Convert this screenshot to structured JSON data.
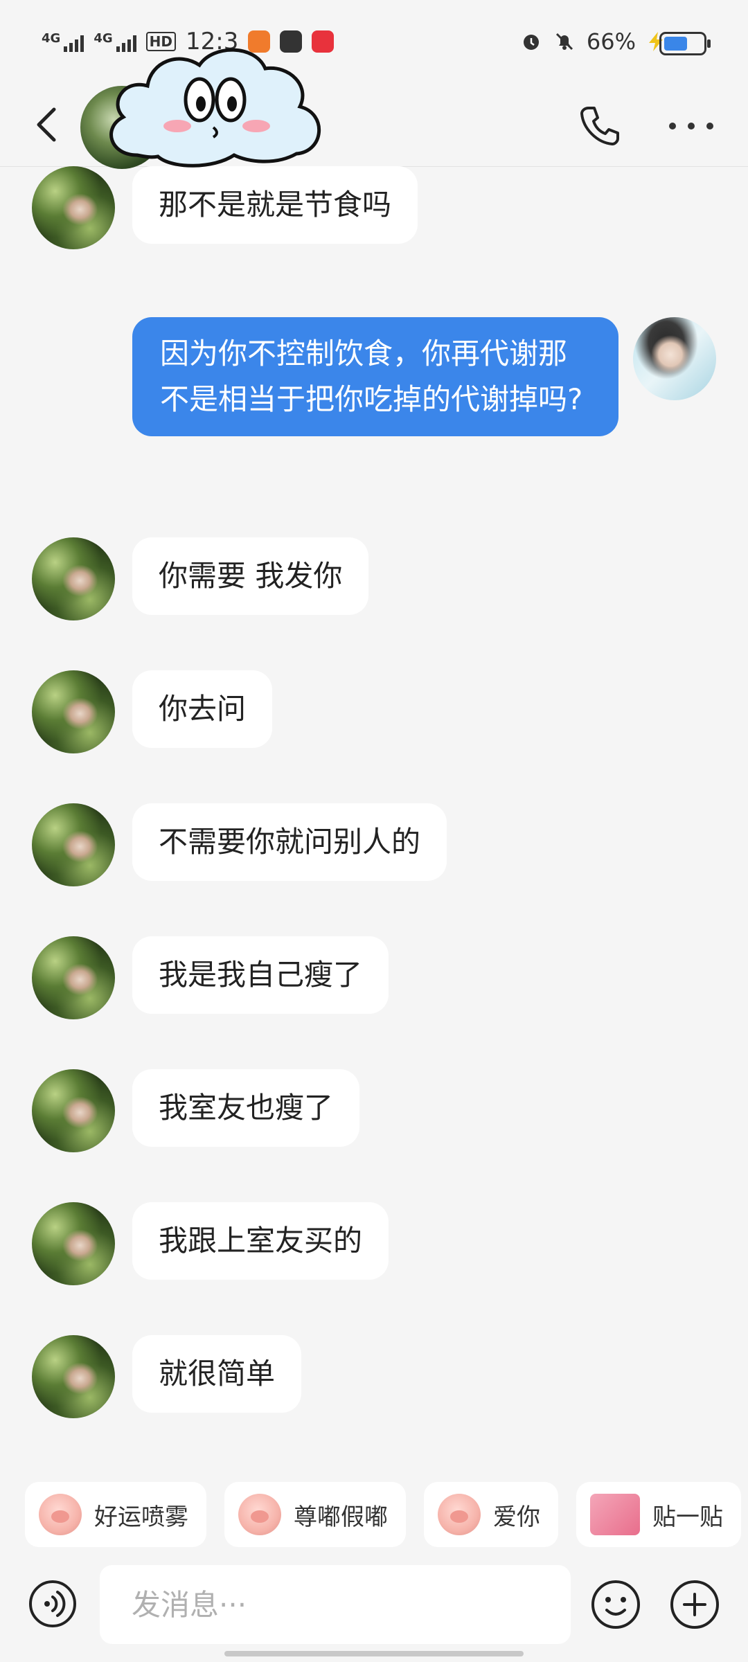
{
  "status_bar": {
    "network1": "4G",
    "network2": "4G",
    "hd": "HD",
    "time": "12:3",
    "battery_pct": "66%",
    "battery_level": 0.66,
    "icons": [
      "signal-icon",
      "hd-icon",
      "vibrate-icon",
      "app-icon",
      "video-app-icon",
      "shop-app-icon",
      "alarm-icon",
      "mute-icon",
      "charging-icon",
      "battery-icon"
    ]
  },
  "header": {
    "back_icon": "chevron-left-icon",
    "sticker": "cloud-face-sticker",
    "call_icon": "phone-icon",
    "more_icon": "more-dots-icon"
  },
  "messages": [
    {
      "side": "left",
      "text": "那不是就是节食吗"
    },
    {
      "side": "right",
      "text": "因为你不控制饮食，你再代谢那不是相当于把你吃掉的代谢掉吗?"
    },
    {
      "side": "left",
      "text": "你需要 我发你"
    },
    {
      "side": "left",
      "text": "你去问"
    },
    {
      "side": "left",
      "text": "不需要你就问别人的"
    },
    {
      "side": "left",
      "text": "我是我自己瘦了"
    },
    {
      "side": "left",
      "text": "我室友也瘦了"
    },
    {
      "side": "left",
      "text": "我跟上室友买的"
    },
    {
      "side": "left",
      "text": "就很简单"
    }
  ],
  "quick_replies": [
    {
      "label": "好运喷雾",
      "icon": "pig-spray-sticker-icon"
    },
    {
      "label": "尊嘟假嘟",
      "icon": "pig-face-sticker-icon"
    },
    {
      "label": "爱你",
      "icon": "pig-love-sticker-icon"
    },
    {
      "label": "贴一贴",
      "icon": "hug-sticker-icon"
    }
  ],
  "input": {
    "placeholder": "发消息···",
    "voice_icon": "voice-icon",
    "emoji_icon": "emoji-icon",
    "plus_icon": "plus-icon"
  },
  "colors": {
    "accent": "#3b86ea",
    "background": "#f5f5f5",
    "bubble": "#ffffff"
  }
}
